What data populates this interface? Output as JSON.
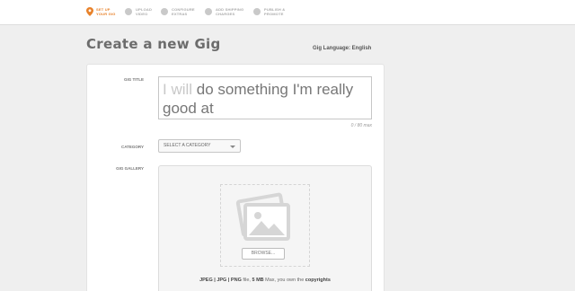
{
  "steps": [
    {
      "line1": "SET UP",
      "line2": "YOUR GIG"
    },
    {
      "line1": "UPLOAD",
      "line2": "VIDEO"
    },
    {
      "line1": "CONFIGURE",
      "line2": "EXTRAS"
    },
    {
      "line1": "ADD SHIPPING",
      "line2": "CHARGES"
    },
    {
      "line1": "PUBLISH &",
      "line2": "PROMOTE"
    }
  ],
  "page": {
    "title": "Create a new Gig",
    "language": "Gig Language: English"
  },
  "form": {
    "title_label": "GIG TITLE",
    "title_prefix": "I will",
    "title_rest": "do something I'm really good at",
    "title_counter": "0 / 80 max",
    "category_label": "CATEGORY",
    "category_value": "SELECT A CATEGORY",
    "gallery_label": "GIG GALLERY",
    "browse_label": "BROWSE...",
    "formats": {
      "types": "JPEG | JPG | PNG",
      "file_word": "file,",
      "size": "5 MB",
      "max_text": "Max, you own the",
      "copyrights": "copyrights"
    }
  },
  "colors": {
    "accent": "#e8822b",
    "inactive_step": "#c9c9c9"
  },
  "icons": {
    "active_step": "map-pin-icon",
    "gallery": "photo-placeholder-icon",
    "select": "caret-down-icon"
  }
}
